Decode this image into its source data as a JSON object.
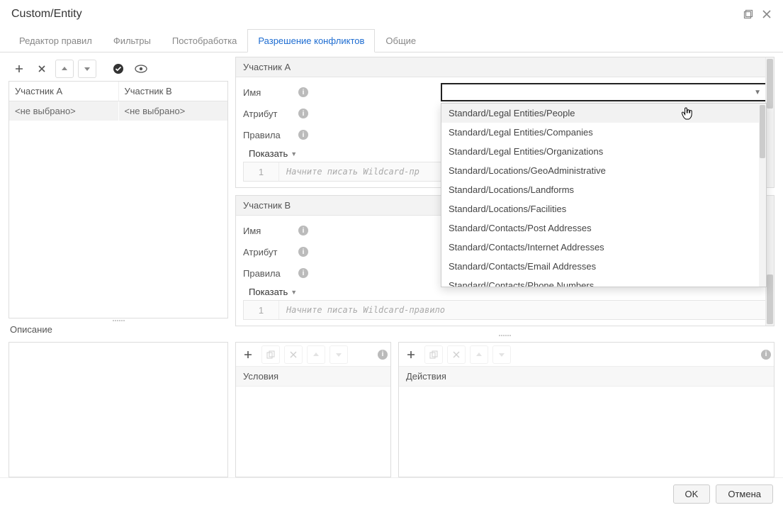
{
  "window": {
    "title": "Custom/Entity"
  },
  "tabs": [
    "Редактор правил",
    "Фильтры",
    "Постобработка",
    "Разрешение конфликтов",
    "Общие"
  ],
  "active_tab_index": 3,
  "participants_grid": {
    "headers": [
      "Участник А",
      "Участник В"
    ],
    "rows": [
      [
        "<не выбрано>",
        "<не выбрано>"
      ]
    ]
  },
  "participant_a": {
    "title": "Участник А",
    "fields": {
      "name": "Имя",
      "attribute": "Атрибут",
      "rules": "Правила"
    },
    "show": "Показать",
    "code_placeholder": "Начните писать Wildcard-пр",
    "line_no": "1"
  },
  "participant_b": {
    "title": "Участник В",
    "fields": {
      "name": "Имя",
      "attribute": "Атрибут",
      "rules": "Правила"
    },
    "show": "Показать",
    "code_placeholder": "Начните писать Wildcard-правило",
    "line_no": "1"
  },
  "dropdown_items": [
    "Standard/Legal Entities/People",
    "Standard/Legal Entities/Companies",
    "Standard/Legal Entities/Organizations",
    "Standard/Locations/GeoAdministrative",
    "Standard/Locations/Landforms",
    "Standard/Locations/Facilities",
    "Standard/Contacts/Post Addresses",
    "Standard/Contacts/Internet Addresses",
    "Standard/Contacts/Email Addresses",
    "Standard/Contacts/Phone Numbers"
  ],
  "description_label": "Описание",
  "conditions_title": "Условия",
  "actions_title": "Действия",
  "buttons": {
    "ok": "OK",
    "cancel": "Отмена"
  }
}
